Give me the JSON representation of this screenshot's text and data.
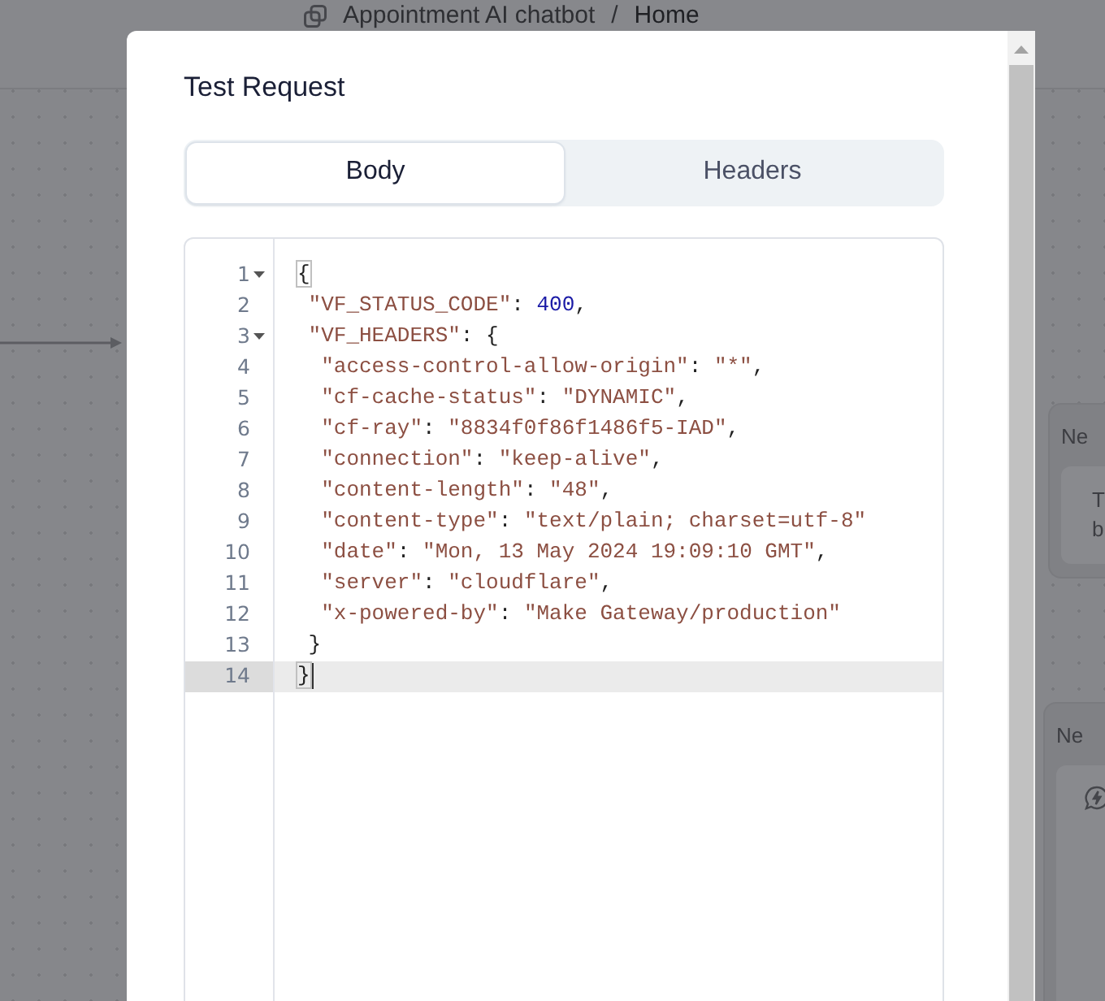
{
  "breadcrumb": {
    "project": "Appointment AI chatbot",
    "separator": "/",
    "page": "Home"
  },
  "dialog": {
    "title": "Test Request",
    "tabs": [
      {
        "label": "Body",
        "selected": true
      },
      {
        "label": "Headers",
        "selected": false
      }
    ],
    "editor": {
      "lines": [
        {
          "number": "1",
          "foldable": true,
          "selected": false,
          "tokens": [
            {
              "kind": "brace",
              "text": "{"
            }
          ]
        },
        {
          "number": "2",
          "foldable": false,
          "selected": false,
          "tokens": [
            {
              "kind": "string",
              "text": " \"VF_STATUS_CODE\""
            },
            {
              "kind": "punct",
              "text": ": "
            },
            {
              "kind": "number",
              "text": "400"
            },
            {
              "kind": "punct",
              "text": ","
            }
          ]
        },
        {
          "number": "3",
          "foldable": true,
          "selected": false,
          "tokens": [
            {
              "kind": "string",
              "text": " \"VF_HEADERS\""
            },
            {
              "kind": "punct",
              "text": ": {"
            }
          ]
        },
        {
          "number": "4",
          "foldable": false,
          "selected": false,
          "tokens": [
            {
              "kind": "string",
              "text": "  \"access-control-allow-origin\""
            },
            {
              "kind": "punct",
              "text": ": "
            },
            {
              "kind": "string",
              "text": "\"*\""
            },
            {
              "kind": "punct",
              "text": ","
            }
          ]
        },
        {
          "number": "5",
          "foldable": false,
          "selected": false,
          "tokens": [
            {
              "kind": "string",
              "text": "  \"cf-cache-status\""
            },
            {
              "kind": "punct",
              "text": ": "
            },
            {
              "kind": "string",
              "text": "\"DYNAMIC\""
            },
            {
              "kind": "punct",
              "text": ","
            }
          ]
        },
        {
          "number": "6",
          "foldable": false,
          "selected": false,
          "tokens": [
            {
              "kind": "string",
              "text": "  \"cf-ray\""
            },
            {
              "kind": "punct",
              "text": ": "
            },
            {
              "kind": "string",
              "text": "\"8834f0f86f1486f5-IAD\""
            },
            {
              "kind": "punct",
              "text": ","
            }
          ]
        },
        {
          "number": "7",
          "foldable": false,
          "selected": false,
          "tokens": [
            {
              "kind": "string",
              "text": "  \"connection\""
            },
            {
              "kind": "punct",
              "text": ": "
            },
            {
              "kind": "string",
              "text": "\"keep-alive\""
            },
            {
              "kind": "punct",
              "text": ","
            }
          ]
        },
        {
          "number": "8",
          "foldable": false,
          "selected": false,
          "tokens": [
            {
              "kind": "string",
              "text": "  \"content-length\""
            },
            {
              "kind": "punct",
              "text": ": "
            },
            {
              "kind": "string",
              "text": "\"48\""
            },
            {
              "kind": "punct",
              "text": ","
            }
          ]
        },
        {
          "number": "9",
          "foldable": false,
          "selected": false,
          "tokens": [
            {
              "kind": "string",
              "text": "  \"content-type\""
            },
            {
              "kind": "punct",
              "text": ": "
            },
            {
              "kind": "string",
              "text": "\"text/plain; charset=utf-8\""
            }
          ]
        },
        {
          "number": "10",
          "foldable": false,
          "selected": false,
          "tokens": [
            {
              "kind": "string",
              "text": "  \"date\""
            },
            {
              "kind": "punct",
              "text": ": "
            },
            {
              "kind": "string",
              "text": "\"Mon, 13 May 2024 19:09:10 GMT\""
            },
            {
              "kind": "punct",
              "text": ","
            }
          ]
        },
        {
          "number": "11",
          "foldable": false,
          "selected": false,
          "tokens": [
            {
              "kind": "string",
              "text": "  \"server\""
            },
            {
              "kind": "punct",
              "text": ": "
            },
            {
              "kind": "string",
              "text": "\"cloudflare\""
            },
            {
              "kind": "punct",
              "text": ","
            }
          ]
        },
        {
          "number": "12",
          "foldable": false,
          "selected": false,
          "tokens": [
            {
              "kind": "string",
              "text": "  \"x-powered-by\""
            },
            {
              "kind": "punct",
              "text": ": "
            },
            {
              "kind": "string",
              "text": "\"Make Gateway/production\""
            }
          ]
        },
        {
          "number": "13",
          "foldable": false,
          "selected": false,
          "tokens": [
            {
              "kind": "punct",
              "text": " }"
            }
          ]
        },
        {
          "number": "14",
          "foldable": false,
          "selected": true,
          "tokens": [
            {
              "kind": "brace",
              "text": "}"
            }
          ]
        }
      ]
    }
  },
  "background_cards": [
    {
      "title": "Ne",
      "kind": "text",
      "body_lines": [
        "T",
        "b"
      ]
    },
    {
      "title": "Ne",
      "kind": "icon"
    }
  ]
}
